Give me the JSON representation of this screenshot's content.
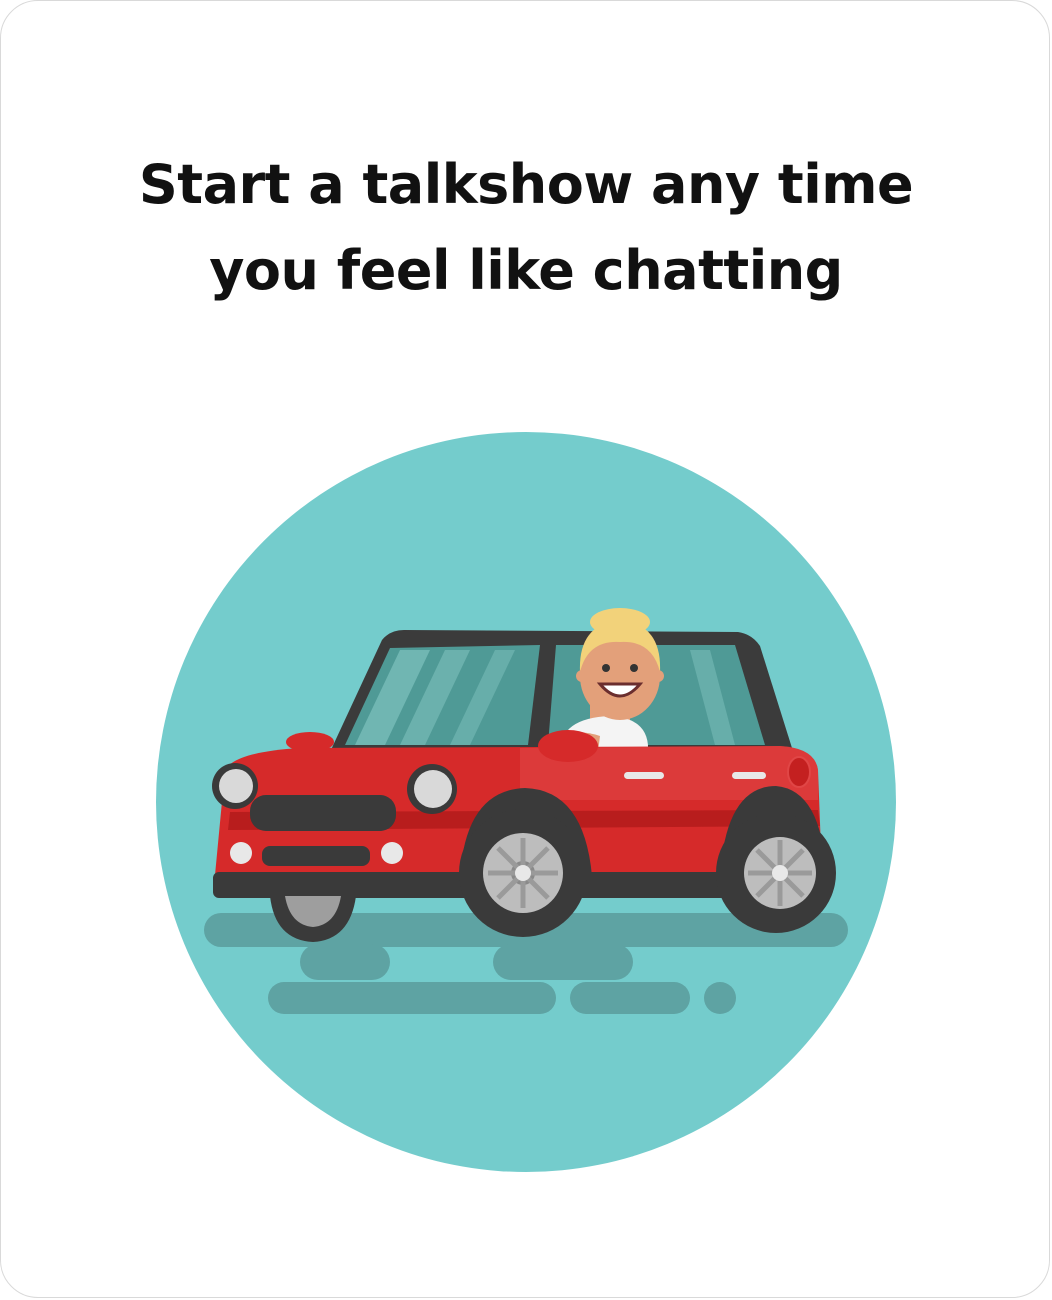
{
  "headline": {
    "line1": "Start a talkshow any time",
    "line2": "you feel like chatting"
  },
  "illustration": {
    "icon": "car-driver-illustration",
    "colors": {
      "circle": "#74cccc",
      "road": "#5ea3a3",
      "car_body": "#d62a2a",
      "car_trim": "#3a3a3a",
      "window": "#4f9a96",
      "hair": "#f2d27a",
      "skin": "#e3a07a"
    }
  }
}
